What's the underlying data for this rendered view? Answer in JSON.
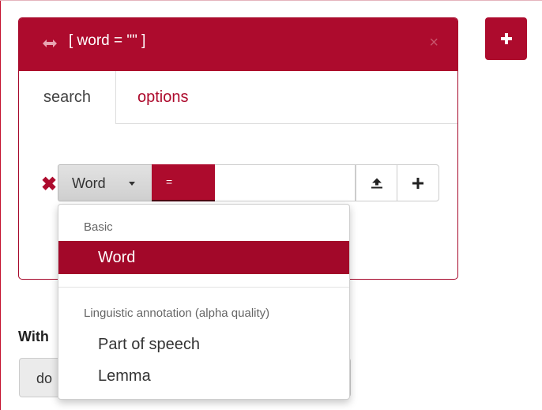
{
  "token": {
    "title": "[ word = \"\" ]",
    "close_label": "×",
    "tabs": [
      {
        "label": "search"
      },
      {
        "label": "options"
      }
    ],
    "condition": {
      "attribute": "Word",
      "operator": "=",
      "value": ""
    }
  },
  "within": {
    "label": "With",
    "button_text": "do"
  },
  "dropdown": {
    "groups": [
      {
        "header": "Basic",
        "items": [
          {
            "label": "Word",
            "selected": true
          }
        ]
      },
      {
        "header": "Linguistic annotation (alpha quality)",
        "items": [
          {
            "label": "Part of speech"
          },
          {
            "label": "Lemma"
          }
        ]
      }
    ]
  },
  "colors": {
    "accent": "#ad0b2d",
    "selected": "#a20829"
  },
  "icons": {
    "move": "left-right-arrow-icon",
    "close": "close-icon",
    "remove": "remove-condition-icon",
    "upload": "upload-icon",
    "add_condition": "plus-icon",
    "add_token": "plus-icon"
  }
}
